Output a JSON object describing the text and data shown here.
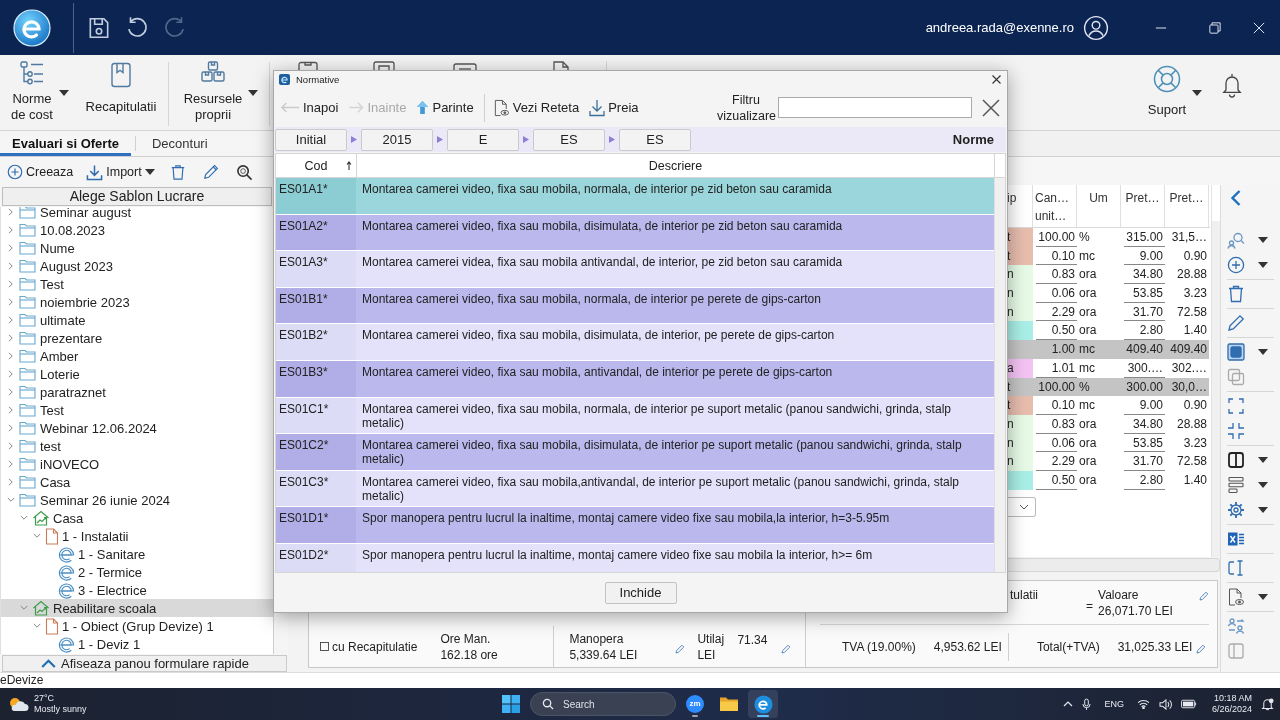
{
  "title_bar": {
    "user_email": "andreea.rada@exenne.ro"
  },
  "ribbon": {
    "items": [
      {
        "label": "Norme de cost",
        "has_menu": true
      },
      {
        "label": "Recapitulatii",
        "has_menu": false
      },
      {
        "label": "Resursele proprii",
        "has_menu": true
      }
    ],
    "support": {
      "label": "Suport",
      "has_menu": true
    }
  },
  "left_panel": {
    "tabs": [
      {
        "label": "Evaluari si Oferte",
        "selected": true
      },
      {
        "label": "Deconturi",
        "selected": false
      }
    ],
    "toolbar": [
      {
        "label": "Creeaza",
        "has_menu": false
      },
      {
        "label": "Import",
        "has_menu": true
      }
    ],
    "template_button": "Alege Sablon Lucrare",
    "tree": [
      {
        "label": "Seminar august",
        "kind": "folder",
        "expanded": false,
        "selected": false
      },
      {
        "label": "10.08.2023",
        "kind": "folder",
        "expanded": false,
        "selected": false
      },
      {
        "label": "Nume",
        "kind": "folder",
        "expanded": false,
        "selected": false
      },
      {
        "label": "August 2023",
        "kind": "folder",
        "expanded": false,
        "selected": false
      },
      {
        "label": "Test",
        "kind": "folder",
        "expanded": false,
        "selected": false
      },
      {
        "label": "noiembrie 2023",
        "kind": "folder",
        "expanded": false,
        "selected": false
      },
      {
        "label": "ultimate",
        "kind": "folder",
        "expanded": false,
        "selected": false
      },
      {
        "label": "prezentare",
        "kind": "folder",
        "expanded": false,
        "selected": false
      },
      {
        "label": "Amber",
        "kind": "folder",
        "expanded": false,
        "selected": false
      },
      {
        "label": "Loterie",
        "kind": "folder",
        "expanded": false,
        "selected": false
      },
      {
        "label": "paratraznet",
        "kind": "folder",
        "expanded": false,
        "selected": false
      },
      {
        "label": "Test",
        "kind": "folder",
        "expanded": false,
        "selected": false
      },
      {
        "label": "Webinar 12.06.2024",
        "kind": "folder",
        "expanded": false,
        "selected": false
      },
      {
        "label": "test",
        "kind": "folder",
        "expanded": false,
        "selected": false
      },
      {
        "label": "iNOVECO",
        "kind": "folder",
        "expanded": false,
        "selected": false
      },
      {
        "label": "Casa",
        "kind": "folder",
        "expanded": false,
        "selected": false
      },
      {
        "label": "Seminar 26 iunie 2024",
        "kind": "folder",
        "expanded": true,
        "selected": false,
        "children": [
          {
            "label": "Casa",
            "kind": "project",
            "expanded": true,
            "selected": false,
            "children": [
              {
                "label": "1 - Instalatii",
                "kind": "object",
                "expanded": true,
                "selected": false,
                "children": [
                  {
                    "label": "1 - Sanitare",
                    "kind": "estimate",
                    "selected": false
                  },
                  {
                    "label": "2 - Termice",
                    "kind": "estimate",
                    "selected": false
                  },
                  {
                    "label": "3 - Electrice",
                    "kind": "estimate",
                    "selected": false
                  }
                ]
              }
            ]
          },
          {
            "label": "Reabilitare scoala",
            "kind": "project",
            "expanded": true,
            "selected": true,
            "children": [
              {
                "label": "1 - Obiect (Grup Devize) 1",
                "kind": "object",
                "expanded": true,
                "selected": false,
                "children": [
                  {
                    "label": "1 - Deviz 1",
                    "kind": "estimate",
                    "selected": false
                  }
                ]
              }
            ]
          }
        ]
      }
    ],
    "quick_forms_button": "Afiseaza panou formulare rapide"
  },
  "estimate_table": {
    "columns": [
      "ip",
      "Can… unit…",
      "Um",
      "Pret…",
      "Pret…"
    ],
    "rows": [
      {
        "kind": "item",
        "color": "#e7bdae",
        "cells": [
          "t",
          "100.00",
          "%",
          "315.00",
          "31,5…"
        ]
      },
      {
        "kind": "item",
        "color": "#e7bdae",
        "cells": [
          "t",
          "0.10",
          "mc",
          "9.00",
          "0.90"
        ]
      },
      {
        "kind": "item",
        "color": "#e6fae6",
        "cells": [
          "n",
          "0.83",
          "ora",
          "34.80",
          "28.88"
        ]
      },
      {
        "kind": "item",
        "color": "#e6fae6",
        "cells": [
          "n",
          "0.06",
          "ora",
          "53.85",
          "3.23"
        ]
      },
      {
        "kind": "item",
        "color": "#e6fae6",
        "cells": [
          "n",
          "2.29",
          "ora",
          "31.70",
          "72.58"
        ]
      },
      {
        "kind": "item",
        "color": "#a9efe7",
        "cells": [
          null,
          "0.50",
          "ora",
          "2.80",
          "1.40"
        ]
      },
      {
        "kind": "group",
        "color": "#c4c4c4",
        "cells": [
          null,
          "1.00",
          "mc",
          "409.40",
          "409.40"
        ]
      },
      {
        "kind": "item",
        "color": "#f4c3f4",
        "cells": [
          "a",
          "1.01",
          "mc",
          "300.…",
          "302.…"
        ]
      },
      {
        "kind": "group",
        "color": "#c4c4c4",
        "cells": [
          "t",
          "100.00",
          "%",
          "300.00",
          "30,0…"
        ]
      },
      {
        "kind": "item",
        "color": "#e7bdae",
        "cells": [
          "t",
          "0.10",
          "mc",
          "9.00",
          "0.90"
        ]
      },
      {
        "kind": "item",
        "color": "#e6fae6",
        "cells": [
          "n",
          "0.83",
          "ora",
          "34.80",
          "28.88"
        ]
      },
      {
        "kind": "item",
        "color": "#e6fae6",
        "cells": [
          "n",
          "0.06",
          "ora",
          "53.85",
          "3.23"
        ]
      },
      {
        "kind": "item",
        "color": "#e6fae6",
        "cells": [
          "n",
          "2.29",
          "ora",
          "31.70",
          "72.58"
        ]
      },
      {
        "kind": "item",
        "color": "#a9efe7",
        "cells": [
          null,
          "0.50",
          "ora",
          "2.80",
          "1.40"
        ]
      }
    ]
  },
  "summary": {
    "recap_label_fragment": "tulatii",
    "equals_sign": "=",
    "value": {
      "label": "Valoare",
      "amount": "26,071.70 LEI"
    },
    "include_recap": {
      "label": "cu Recapitulatie",
      "checked": false
    },
    "man_hours": {
      "label": "Ore Man.",
      "amount": "162.18 ore"
    },
    "labour": {
      "label": "Manopera",
      "amount": "5,339.64 LEI"
    },
    "equipment": {
      "label": "Utilaj",
      "amount": "71.34",
      "unit": "LEI"
    },
    "vat": {
      "label": "TVA (19.00%)",
      "amount": "4,953.62 LEI"
    },
    "total": {
      "label": "Total(+TVA)",
      "amount": "31,025.33 LEI"
    }
  },
  "dialog": {
    "title": "Normative",
    "toolbar": [
      {
        "label": "Inapoi",
        "disabled": false
      },
      {
        "label": "Inainte",
        "disabled": true
      },
      {
        "label": "Parinte",
        "disabled": false
      },
      {
        "label": "Vezi Reteta",
        "disabled": false
      },
      {
        "label": "Preia",
        "disabled": false
      }
    ],
    "filter": {
      "label": "Filtru vizualizare"
    },
    "breadcrumbs": [
      "Initial",
      "2015",
      "E",
      "ES",
      "ES"
    ],
    "level_label": "Norme",
    "columns": [
      {
        "label": "Cod",
        "sorted": true
      },
      {
        "label": "Descriere",
        "sorted": false
      }
    ],
    "rows": [
      {
        "code": "ES01A1*",
        "description": "Montarea camerei video, fixa sau mobila, normala, de interior pe zid beton sau caramida",
        "selected": true
      },
      {
        "code": "ES01A2*",
        "description": "Montarea camerei video, fixa sau mobila, disimulata, de interior pe zid beton sau caramida",
        "selected": false
      },
      {
        "code": "ES01A3*",
        "description": "Montarea camerei videa, fixa sau mobila antivandal, de interior, pe zid beton sau caramida",
        "selected": false
      },
      {
        "code": "ES01B1*",
        "description": "Montarea camerei video, fixa sau mobila, normala, de interior pe perete de gips-carton",
        "selected": false
      },
      {
        "code": "ES01B2*",
        "description": "Montarea camerei video, fixa sau mobila, disimulata, de interior, pe perete de gips-carton",
        "selected": false
      },
      {
        "code": "ES01B3*",
        "description": "Montarea camerei video, fixa sau mobila, antivandal, de interior pe perete de gips-carton",
        "selected": false
      },
      {
        "code": "ES01C1*",
        "description": "Montarea camerei video, fixa sau mobila, normala, de interior pe suport metalic (panou sandwichi, grinda, stalp metalic)",
        "selected": false
      },
      {
        "code": "ES01C2*",
        "description": "Montarea camerei video, fixa sau mobila, disimulata, de interior pe suport metalic (panou sandwichi, grinda, stalp metalic)",
        "selected": false
      },
      {
        "code": "ES01C3*",
        "description": "Montarea camerei video, fixa sau mobila,antivandal, de interior pe suport metalic (panou sandwichi, grinda, stalp metalic)",
        "selected": false
      },
      {
        "code": "ES01D1*",
        "description": "Spor manopera pentru lucrul la inaltime, montaj camere video fixe sau mobila,la interior, h=3-5.95m",
        "selected": false
      },
      {
        "code": "ES01D2*",
        "description": "Spor manopera pentru lucrul la inaltime, montaj camere video fixe sau mobila la interior, h>= 6m",
        "selected": false
      }
    ],
    "close_button": "Inchide"
  },
  "status_bar": "eDevize",
  "taskbar": {
    "weather": {
      "temperature": "27°C",
      "condition": "Mostly sunny"
    },
    "search": {
      "placeholder": "Search"
    },
    "apps": [
      {
        "kind": "meeting",
        "label": "zm",
        "selected": false,
        "running": true
      },
      {
        "kind": "files",
        "selected": false,
        "running": false
      },
      {
        "kind": "estimator",
        "selected": true,
        "running": true
      }
    ],
    "language": "ENG",
    "time": "10:18 AM",
    "date": "6/26/2024"
  }
}
